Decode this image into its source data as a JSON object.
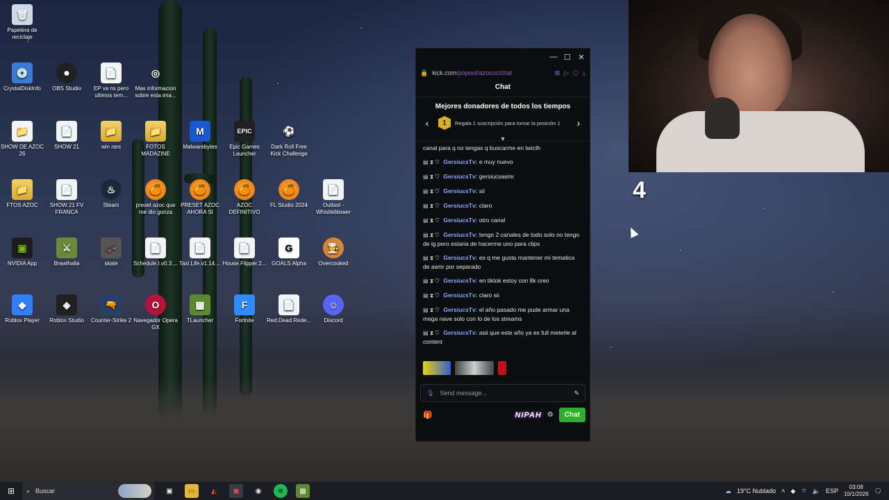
{
  "desktop": {
    "icons": [
      {
        "label": "Papelera de reciclaje",
        "glyph": "🗑"
      },
      {
        "label": "CrystalDiskInfo",
        "glyph": "💿"
      },
      {
        "label": "OBS Studio",
        "glyph": "⏺"
      },
      {
        "label": "EP va ns pero ultimos tem...",
        "glyph": "📄"
      },
      {
        "label": "Mas informacion sobre esta ima...",
        "glyph": "◎"
      },
      {
        "label": "SHOW DE AZOC 26",
        "glyph": "📁"
      },
      {
        "label": "SHOW 21",
        "glyph": "📄"
      },
      {
        "label": "win rars",
        "glyph": "📁"
      },
      {
        "label": "FOTOS MADAZINE",
        "glyph": "📁"
      },
      {
        "label": "Malwarebytes",
        "glyph": "M"
      },
      {
        "label": "Epic Games Launcher",
        "glyph": "EPIC"
      },
      {
        "label": "Dark Roll Free Kick Challenge",
        "glyph": "⚽"
      },
      {
        "label": "FTOS AZOC",
        "glyph": "📁"
      },
      {
        "label": "SHOW 21 FV FRANCA",
        "glyph": "📄"
      },
      {
        "label": "Steam",
        "glyph": "♨"
      },
      {
        "label": "preset azoc que me dio gonza",
        "glyph": "🍊"
      },
      {
        "label": "PRESET AZOC AHORA SI",
        "glyph": "🍊"
      },
      {
        "label": "AZOC DEFINITIVO",
        "glyph": "🍊"
      },
      {
        "label": "FL Studio 2024",
        "glyph": "🍊"
      },
      {
        "label": "Outlast - Whistleblower",
        "glyph": "📄"
      },
      {
        "label": "NVIDIA App",
        "glyph": "▣"
      },
      {
        "label": "Brawlhalla",
        "glyph": "⚔"
      },
      {
        "label": "skate",
        "glyph": "🛹"
      },
      {
        "label": "Schedule.I.v0.3....",
        "glyph": "📄"
      },
      {
        "label": "Taxi.Life.v1.14....",
        "glyph": "📄"
      },
      {
        "label": "House.Flipper.2...",
        "glyph": "📄"
      },
      {
        "label": "GOALS Alpha",
        "glyph": "G"
      },
      {
        "label": "Overcooked",
        "glyph": "👨‍🍳"
      },
      {
        "label": "Roblox Player",
        "glyph": "◆"
      },
      {
        "label": "Roblox Studio",
        "glyph": "◈"
      },
      {
        "label": "Counter-Strike 2",
        "glyph": "🔫"
      },
      {
        "label": "Navegador Opera GX",
        "glyph": "O"
      },
      {
        "label": "TLauncher",
        "glyph": "▩"
      },
      {
        "label": "Fortnite",
        "glyph": "F"
      },
      {
        "label": "Red.Dead.Rede...",
        "glyph": "📄"
      },
      {
        "label": "Discord",
        "glyph": "☺"
      }
    ]
  },
  "chat_window": {
    "titlebar": {
      "minimize": "—",
      "maximize": "☐",
      "close": "✕"
    },
    "url_host": "kick.com",
    "url_path": "/popout/azoccc/chat",
    "title": "Chat",
    "donors_title": "Mejores donadores de todos los tiempos",
    "donor_rank": "1",
    "donor_text": "Regala 1 suscripción para tomar la posición 1",
    "first_line": "canal para q no tengas q buscarme en twicth",
    "messages": [
      {
        "user": "GersiucsTv:",
        "text": "e muy nuevo"
      },
      {
        "user": "GersiucsTv:",
        "text": "gersiucsasmr"
      },
      {
        "user": "GersiucsTv:",
        "text": "sii"
      },
      {
        "user": "GersiucsTv:",
        "text": "claro"
      },
      {
        "user": "GersiucsTv:",
        "text": "otro canal"
      },
      {
        "user": "GersiucsTv:",
        "text": "tengo 2 canales de todo solo no tengo de ig pero estaria de hacerme uno para clips"
      },
      {
        "user": "GersiucsTv:",
        "text": "es q me gusta mantener mi tematica de asmr por separado"
      },
      {
        "user": "GersiucsTv:",
        "text": "en tiktok estoy con 8k creo"
      },
      {
        "user": "GersiucsTv:",
        "text": "claro sii"
      },
      {
        "user": "GersiucsTv:",
        "text": "el año pasado me pude armar una mega nave solo con lo de los streams"
      },
      {
        "user": "GersiucsTv:",
        "text": "asii que este año ya es full meterle al content"
      }
    ],
    "input_placeholder": "Send message...",
    "nipah_label": "NIPAH",
    "chat_button": "Chat"
  },
  "overlay": {
    "number": "4"
  },
  "taskbar": {
    "search_placeholder": "Buscar",
    "weather": "19°C Nublado",
    "language": "ESP",
    "time": "03:08",
    "date": "10/1/2026"
  },
  "colors": {
    "kick_green": "#53fc18",
    "username": "#8ea7ff",
    "accent_purple": "#9b59d0"
  }
}
